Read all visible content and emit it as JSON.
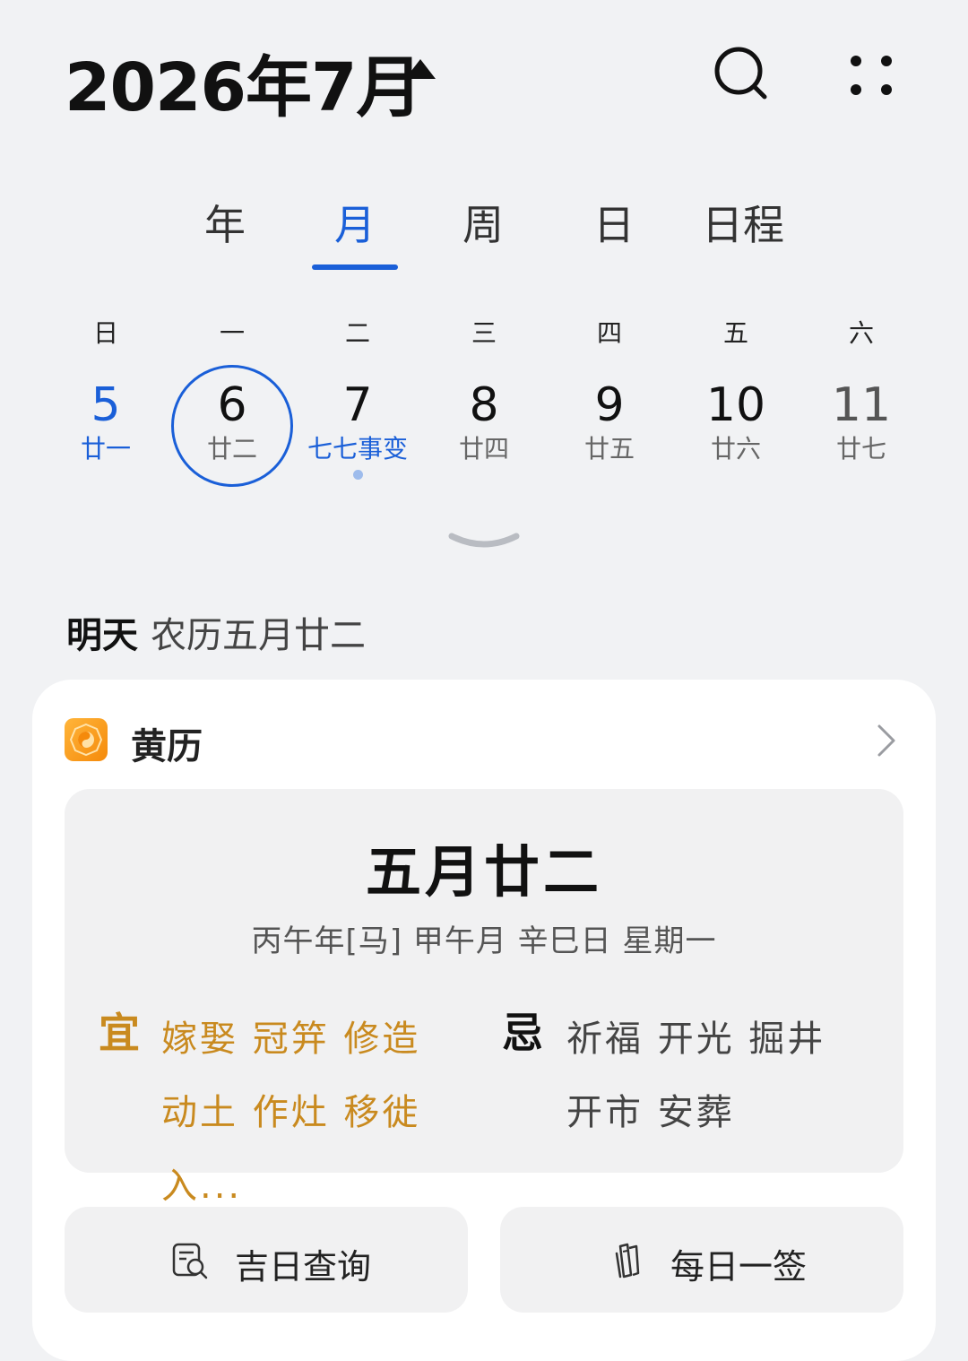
{
  "header": {
    "title": "2026年7月",
    "caret_icon": "caret-up-icon",
    "search_icon": "search-icon",
    "more_icon": "more-dots-icon"
  },
  "tabs": [
    {
      "label": "年",
      "active": false
    },
    {
      "label": "月",
      "active": true
    },
    {
      "label": "周",
      "active": false
    },
    {
      "label": "日",
      "active": false
    },
    {
      "label": "日程",
      "active": false
    }
  ],
  "weekdays": [
    "日",
    "一",
    "二",
    "三",
    "四",
    "五",
    "六"
  ],
  "week": [
    {
      "day": "5",
      "lunar": "廿一"
    },
    {
      "day": "6",
      "lunar": "廿二",
      "selected": true
    },
    {
      "day": "7",
      "lunar": "七七事变",
      "has_event": true
    },
    {
      "day": "8",
      "lunar": "廿四"
    },
    {
      "day": "9",
      "lunar": "廿五"
    },
    {
      "day": "10",
      "lunar": "廿六"
    },
    {
      "day": "11",
      "lunar": "廿七"
    }
  ],
  "expand_icon": "chevron-down-icon",
  "selected_info": {
    "relative": "明天",
    "lunar": "农历五月廿二"
  },
  "almanac_card": {
    "title": "黄历",
    "date": "五月廿二",
    "ganzhi": "丙午年[马]  甲午月 辛巳日 星期一",
    "yi_label": "宜",
    "yi_text": "嫁娶 冠笄 修造 动土 作灶 移徙 入...",
    "ji_label": "忌",
    "ji_text": "祈福 开光 掘井 开市 安葬",
    "colors": {
      "yi": "#c98a1f",
      "accent": "#1a5fd8"
    }
  },
  "actions": {
    "lucky_day_label": "吉日查询",
    "daily_lot_label": "每日一签"
  }
}
